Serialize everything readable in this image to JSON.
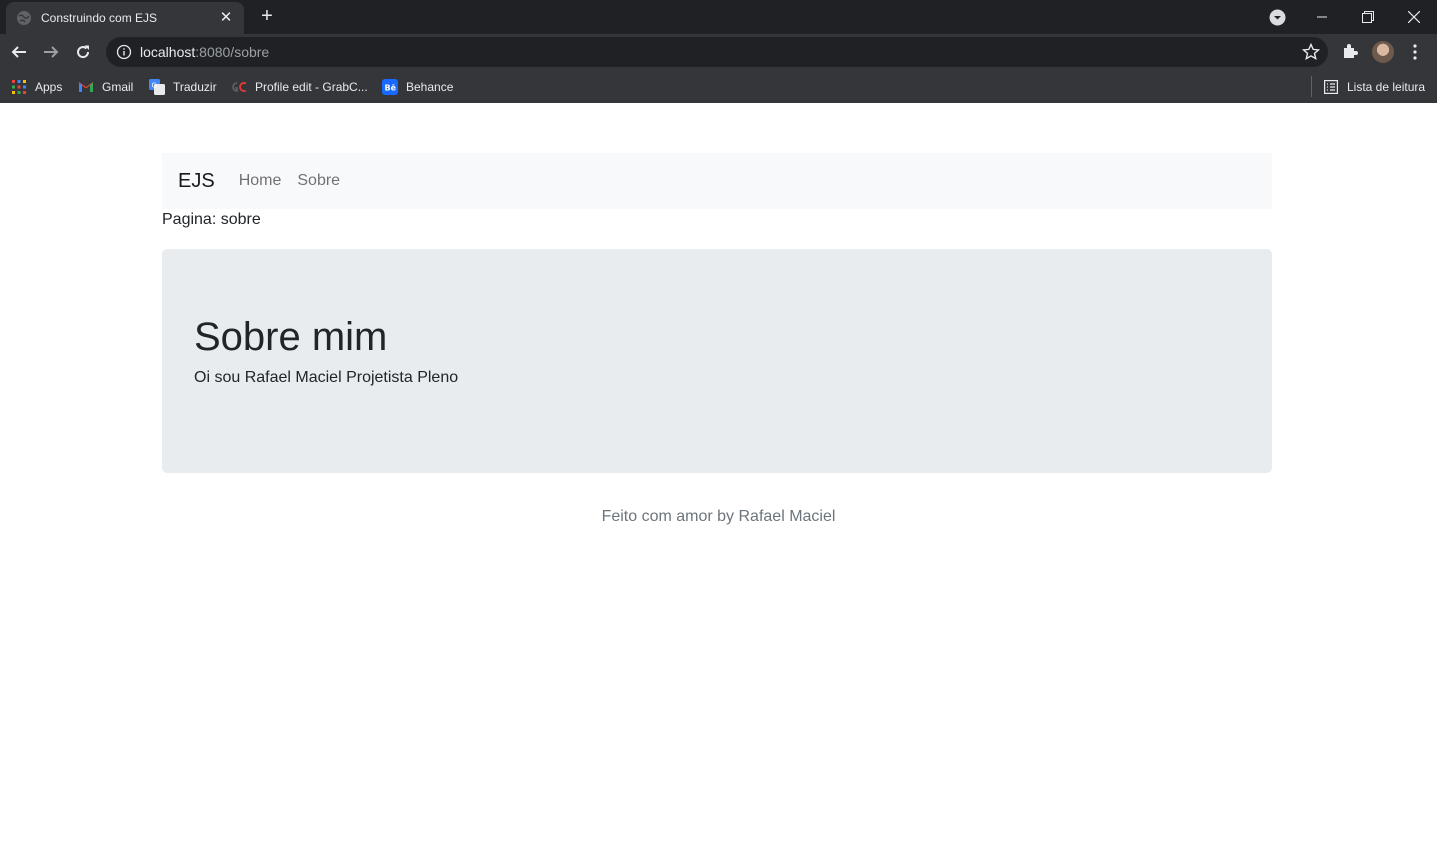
{
  "browser": {
    "tab": {
      "title": "Construindo com EJS",
      "close": "✕"
    },
    "new_tab": "+",
    "url": {
      "host": "localhost",
      "rest": ":8080/sobre"
    },
    "bookmarks": [
      {
        "label": "Apps",
        "icon": "apps-grid-icon"
      },
      {
        "label": "Gmail",
        "icon": "gmail-icon"
      },
      {
        "label": "Traduzir",
        "icon": "translate-icon"
      },
      {
        "label": "Profile edit - GrabC...",
        "icon": "grabcad-icon"
      },
      {
        "label": "Behance",
        "icon": "behance-icon"
      }
    ],
    "reading_list": "Lista de leitura",
    "colors": {
      "frame": "#202124",
      "toolbar": "#35363a",
      "text": "#e8eaed"
    }
  },
  "navbar": {
    "brand": "EJS",
    "links": [
      "Home",
      "Sobre"
    ]
  },
  "page_label": "Pagina: sobre",
  "jumbotron": {
    "title": "Sobre mim",
    "text": "Oi sou Rafael Maciel Projetista Pleno"
  },
  "footer": "Feito com amor by Rafael Maciel",
  "colors": {
    "navbar_bg": "#f8f9fa",
    "jumbotron_bg": "#e9ecef",
    "muted_text": "#6c757d"
  }
}
